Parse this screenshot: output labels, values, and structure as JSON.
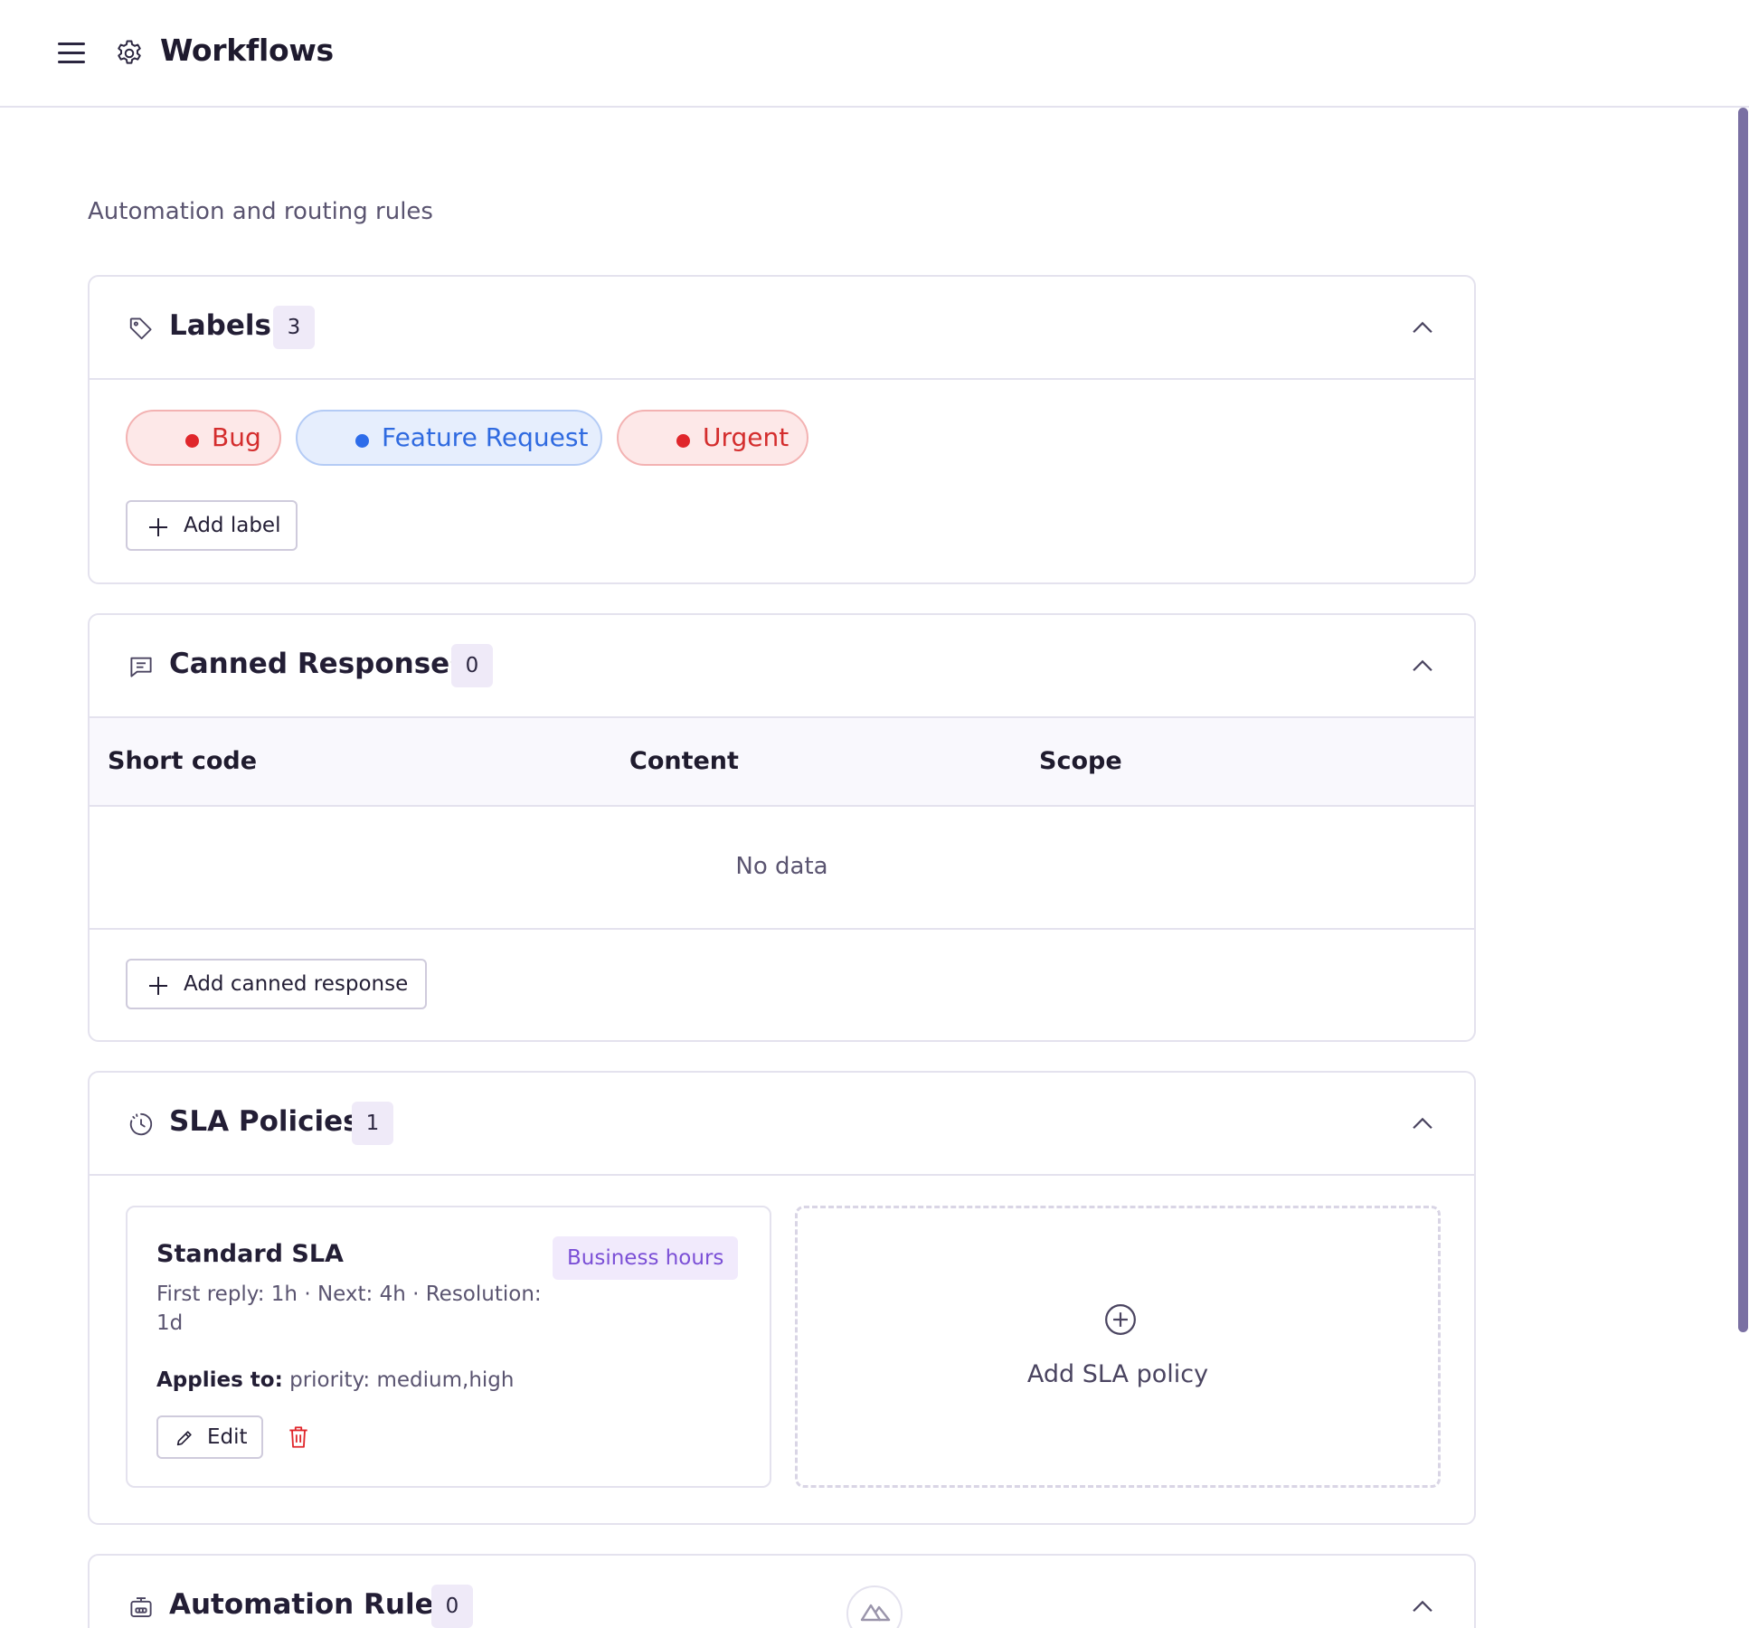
{
  "header": {
    "title": "Workflows"
  },
  "page": {
    "subtitle": "Automation and routing rules"
  },
  "labels": {
    "title": "Labels",
    "count": "3",
    "items": [
      {
        "name": "Bug",
        "color": "#e0262b"
      },
      {
        "name": "Feature Request",
        "color": "#2d6cea"
      },
      {
        "name": "Urgent",
        "color": "#e0262b"
      }
    ],
    "add_label": "Add label"
  },
  "canned": {
    "title": "Canned Responses",
    "count": "0",
    "columns": [
      "Short code",
      "Content",
      "Scope"
    ],
    "empty": "No data",
    "add_label": "Add canned response"
  },
  "sla": {
    "title": "SLA Policies",
    "count": "1",
    "policies": [
      {
        "name": "Standard SLA",
        "badge": "Business hours",
        "meta": "First reply: 1h · Next: 4h · Resolution: 1d",
        "applies_label": "Applies to:",
        "applies_value": "priority: medium,high",
        "edit_label": "Edit"
      }
    ],
    "add_label": "Add SLA policy"
  },
  "automation": {
    "title": "Automation Rules",
    "count": "0"
  },
  "colors": {
    "accent": "#7b4fd6",
    "danger": "#e0262b",
    "info": "#2d6cea"
  }
}
